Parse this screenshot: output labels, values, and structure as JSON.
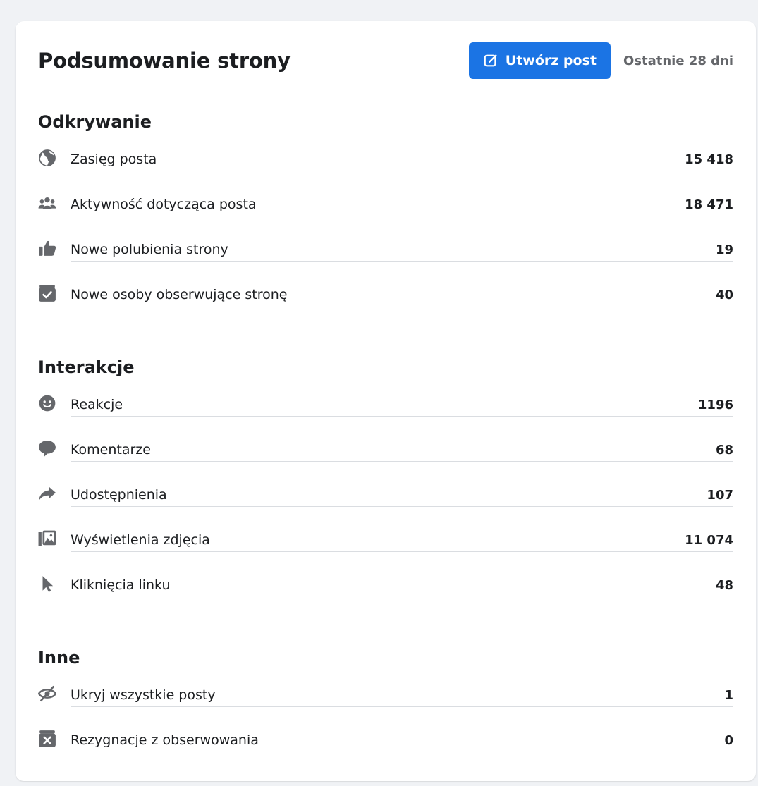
{
  "header": {
    "title": "Podsumowanie strony",
    "create_button_label": "Utwórz post",
    "range_label": "Ostatnie 28 dni"
  },
  "sections": [
    {
      "title": "Odkrywanie",
      "items": [
        {
          "label": "Zasięg posta",
          "value": "15 418",
          "icon": "globe-icon"
        },
        {
          "label": "Aktywność dotycząca posta",
          "value": "18 471",
          "icon": "people-icon"
        },
        {
          "label": "Nowe polubienia strony",
          "value": "19",
          "icon": "thumbs-up-icon"
        },
        {
          "label": "Nowe osoby obserwujące stronę",
          "value": "40",
          "icon": "follow-check-icon"
        }
      ]
    },
    {
      "title": "Interakcje",
      "items": [
        {
          "label": "Reakcje",
          "value": "1196",
          "icon": "smiley-icon"
        },
        {
          "label": "Komentarze",
          "value": "68",
          "icon": "comment-icon"
        },
        {
          "label": "Udostępnienia",
          "value": "107",
          "icon": "share-arrow-icon"
        },
        {
          "label": "Wyświetlenia zdjęcia",
          "value": "11 074",
          "icon": "photo-icon"
        },
        {
          "label": "Kliknięcia linku",
          "value": "48",
          "icon": "cursor-icon"
        }
      ]
    },
    {
      "title": "Inne",
      "items": [
        {
          "label": "Ukryj wszystkie posty",
          "value": "1",
          "icon": "eye-slash-icon"
        },
        {
          "label": "Rezygnacje z obserwowania",
          "value": "0",
          "icon": "unfollow-x-icon"
        }
      ]
    }
  ],
  "colors": {
    "accent": "#1b74e4",
    "icon": "#65676b",
    "background": "#f0f2f5"
  }
}
